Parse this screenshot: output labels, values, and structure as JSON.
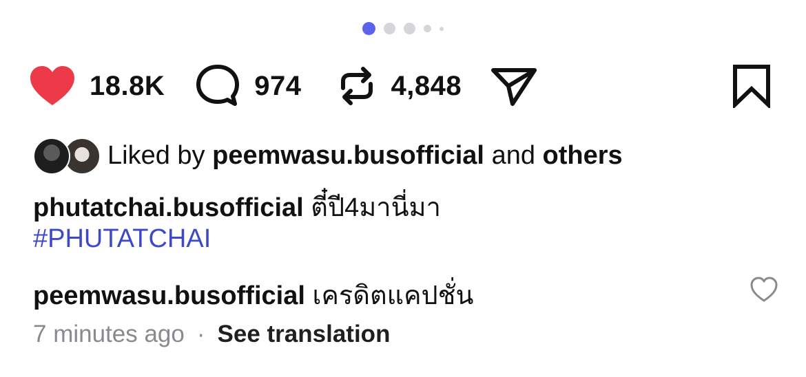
{
  "carousel": {
    "count": 5,
    "active_index": 0
  },
  "actions": {
    "likes": "18.8K",
    "comments": "974",
    "reposts": "4,848"
  },
  "liked_by": {
    "prefix": "Liked by",
    "user": "peemwasu.busofficial",
    "joiner": "and",
    "others": "others"
  },
  "caption": {
    "user": "phutatchai.busofficial",
    "text": "ตี๋ปี4มานี่มา",
    "hashtag": "#PHUTATCHAI"
  },
  "comment": {
    "user": "peemwasu.busofficial",
    "text": "เครดิตแคปชั่น"
  },
  "meta": {
    "time": "7 minutes ago",
    "separator": "·",
    "translate": "See translation"
  },
  "colors": {
    "accent": "#5b63ea",
    "like": "#ed3a48",
    "hashtag": "#3d49c5",
    "muted": "#8a8a8e"
  },
  "icons": [
    "heart-icon",
    "comment-bubble-icon",
    "repost-icon",
    "send-icon",
    "bookmark-icon",
    "heart-outline-icon"
  ]
}
